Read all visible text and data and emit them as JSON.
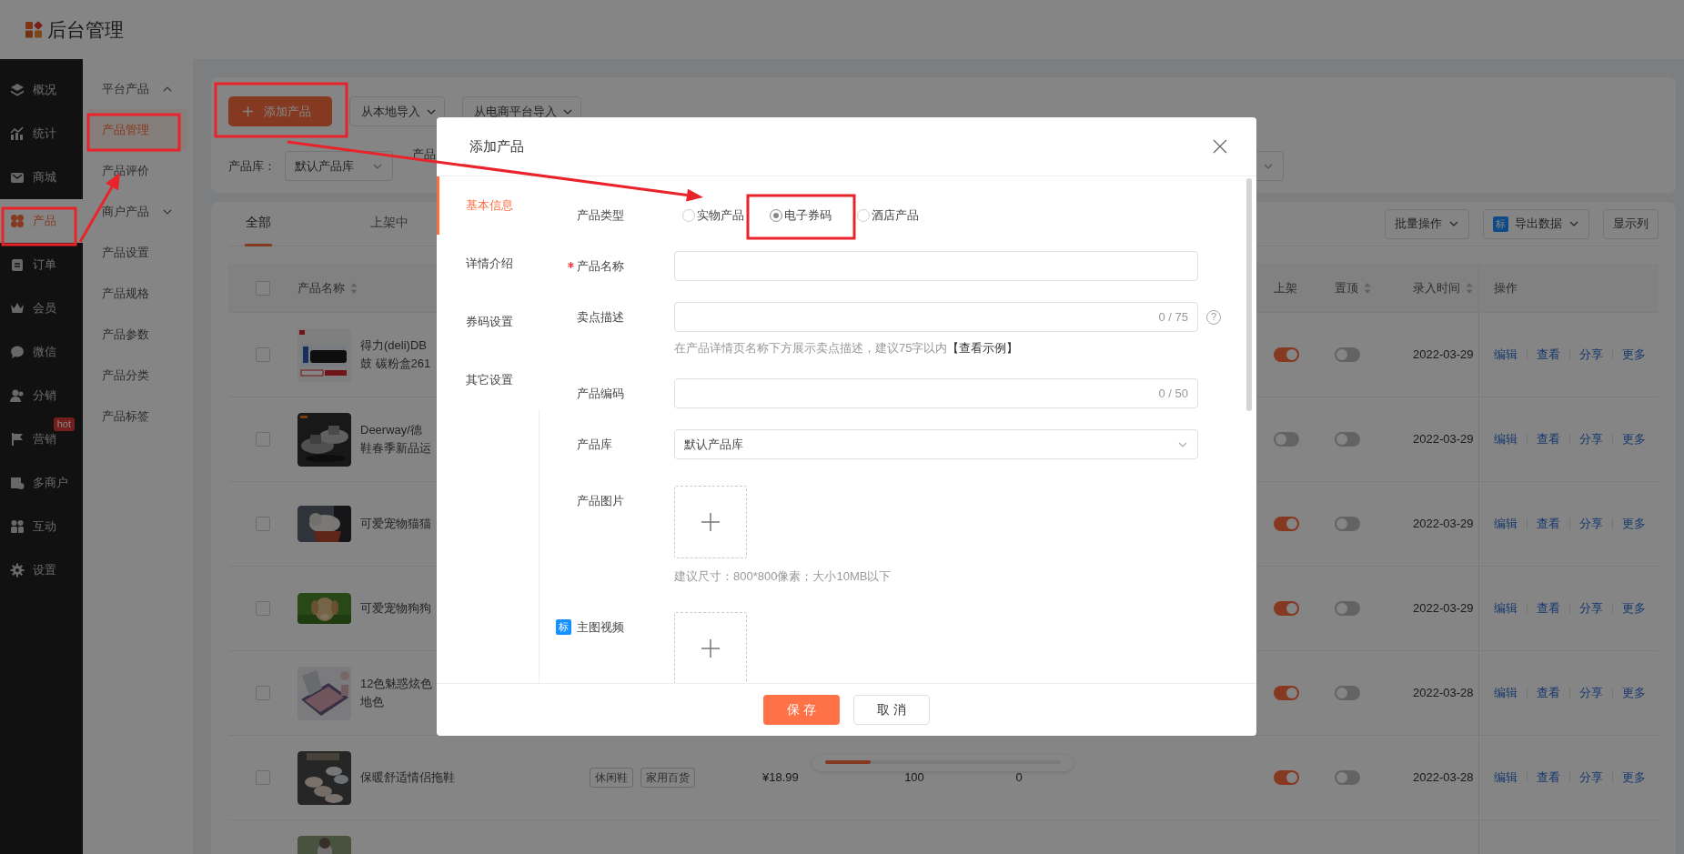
{
  "header": {
    "title": "后台管理"
  },
  "nav": [
    {
      "label": "概况",
      "selected": false
    },
    {
      "label": "统计",
      "selected": false
    },
    {
      "label": "商城",
      "selected": false
    },
    {
      "label": "产品",
      "selected": true
    },
    {
      "label": "订单",
      "selected": false
    },
    {
      "label": "会员",
      "selected": false
    },
    {
      "label": "微信",
      "selected": false
    },
    {
      "label": "分销",
      "selected": false
    },
    {
      "label": "营销",
      "selected": false,
      "badge": "hot"
    },
    {
      "label": "多商户",
      "selected": false
    },
    {
      "label": "互动",
      "selected": false
    },
    {
      "label": "设置",
      "selected": false
    }
  ],
  "subnav": [
    {
      "kind": "group",
      "label": "平台产品",
      "expanded": true,
      "children": [
        {
          "kind": "item",
          "label": "产品管理",
          "selected": true
        },
        {
          "kind": "item",
          "label": "产品评价",
          "selected": false
        }
      ]
    },
    {
      "kind": "group",
      "label": "商户产品",
      "expanded": false
    },
    {
      "kind": "item",
      "label": "产品设置",
      "selected": false
    },
    {
      "kind": "item",
      "label": "产品规格",
      "selected": false
    },
    {
      "kind": "item",
      "label": "产品参数",
      "selected": false
    },
    {
      "kind": "item",
      "label": "产品分类",
      "selected": false
    },
    {
      "kind": "item",
      "label": "产品标签",
      "selected": false
    }
  ],
  "toolbar": {
    "buttons": [
      {
        "kind": "primary",
        "label": "添加产品"
      },
      {
        "kind": "dropdown",
        "label": "从本地导入"
      },
      {
        "kind": "dropdown",
        "label": "从电商平台导入"
      }
    ],
    "filters": [
      {
        "label": "产品库：",
        "value": "默认产品库"
      },
      {
        "label": "产品"
      }
    ]
  },
  "table": {
    "tabs": [
      {
        "label": "全部",
        "selected": true
      },
      {
        "label": "上架中",
        "selected": false
      }
    ],
    "actions": [
      {
        "kind": "dropdown",
        "label": "批量操作"
      },
      {
        "kind": "dropdown",
        "label": "导出数据",
        "badge": "标"
      },
      {
        "kind": "button",
        "label": "显示列"
      }
    ],
    "all_checked": false,
    "columns": [
      {
        "kind": "product",
        "label": "产品名称",
        "sortable": true
      },
      {
        "kind": "shelf",
        "label": "上架",
        "sortable": false
      },
      {
        "kind": "pin",
        "label": "置顶",
        "sortable": true
      },
      {
        "kind": "date",
        "label": "录入时间",
        "sortable": true
      },
      {
        "kind": "actions",
        "label": "操作",
        "sortable": false
      }
    ],
    "rows": [
      {
        "checked": false,
        "image": true,
        "name": [
          "得力(deli)DB",
          "鼓 碳粉盒261"
        ],
        "on_shelf": true,
        "pinned": false,
        "date": "2022-03-29",
        "actions": [
          "编辑",
          "查看",
          "分享",
          "更多"
        ]
      },
      {
        "checked": false,
        "image": true,
        "name": [
          "Deerway/德",
          "鞋春季新品运"
        ],
        "on_shelf": false,
        "pinned": false,
        "date": "2022-03-29",
        "actions": [
          "编辑",
          "查看",
          "分享",
          "更多"
        ]
      },
      {
        "checked": false,
        "image": true,
        "name": [
          "可爱宠物猫猫"
        ],
        "on_shelf": true,
        "pinned": false,
        "date": "2022-03-29",
        "actions": [
          "编辑",
          "查看",
          "分享",
          "更多"
        ]
      },
      {
        "checked": false,
        "image": true,
        "name": [
          "可爱宠物狗狗"
        ],
        "on_shelf": true,
        "pinned": false,
        "date": "2022-03-29",
        "actions": [
          "编辑",
          "查看",
          "分享",
          "更多"
        ]
      },
      {
        "checked": false,
        "image": true,
        "name": [
          "12色魅惑炫色",
          "地色"
        ],
        "on_shelf": true,
        "pinned": false,
        "date": "2022-03-28",
        "actions": [
          "编辑",
          "查看",
          "分享",
          "更多"
        ]
      },
      {
        "checked": false,
        "image": true,
        "name": [
          "保暖舒适情侣拖鞋"
        ],
        "tags": [
          "休闲鞋",
          "家用百货"
        ],
        "price": "¥18.99",
        "stock": "100",
        "sales": "0",
        "on_shelf": true,
        "pinned": false,
        "date": "2022-03-28",
        "actions": [
          "编辑",
          "查看",
          "分享",
          "更多"
        ]
      },
      {
        "image": true
      }
    ]
  },
  "modal": {
    "title": "添加产品",
    "tabs": [
      {
        "label": "基本信息",
        "selected": true
      },
      {
        "label": "详情介绍",
        "selected": false
      },
      {
        "label": "券码设置",
        "selected": false
      },
      {
        "label": "其它设置",
        "selected": false
      }
    ],
    "fields": [
      {
        "kind": "radio",
        "label": "产品类型",
        "required": false,
        "options": [
          {
            "label": "实物产品",
            "selected": false
          },
          {
            "label": "电子券码",
            "selected": true
          },
          {
            "label": "酒店产品",
            "selected": false
          }
        ]
      },
      {
        "kind": "text",
        "label": "产品名称",
        "required": true
      },
      {
        "kind": "text",
        "label": "卖点描述",
        "required": false,
        "counter": "0 / 75",
        "help": "?",
        "hint": "在产品详情页名称下方展示卖点描述，建议75字以内",
        "hint_link": "【查看示例】"
      },
      {
        "kind": "text",
        "label": "产品编码",
        "required": false,
        "counter": "0 / 50"
      },
      {
        "kind": "select",
        "label": "产品库",
        "required": false,
        "value": "默认产品库"
      },
      {
        "kind": "upload",
        "label": "产品图片",
        "required": false,
        "hint": "建议尺寸：800*800像素；大小10MB以下"
      },
      {
        "kind": "upload",
        "label": "主图视频",
        "required": false,
        "badge": "标"
      }
    ],
    "buttons": [
      {
        "kind": "primary",
        "label": "保 存"
      },
      {
        "kind": "default",
        "label": "取 消"
      }
    ]
  }
}
